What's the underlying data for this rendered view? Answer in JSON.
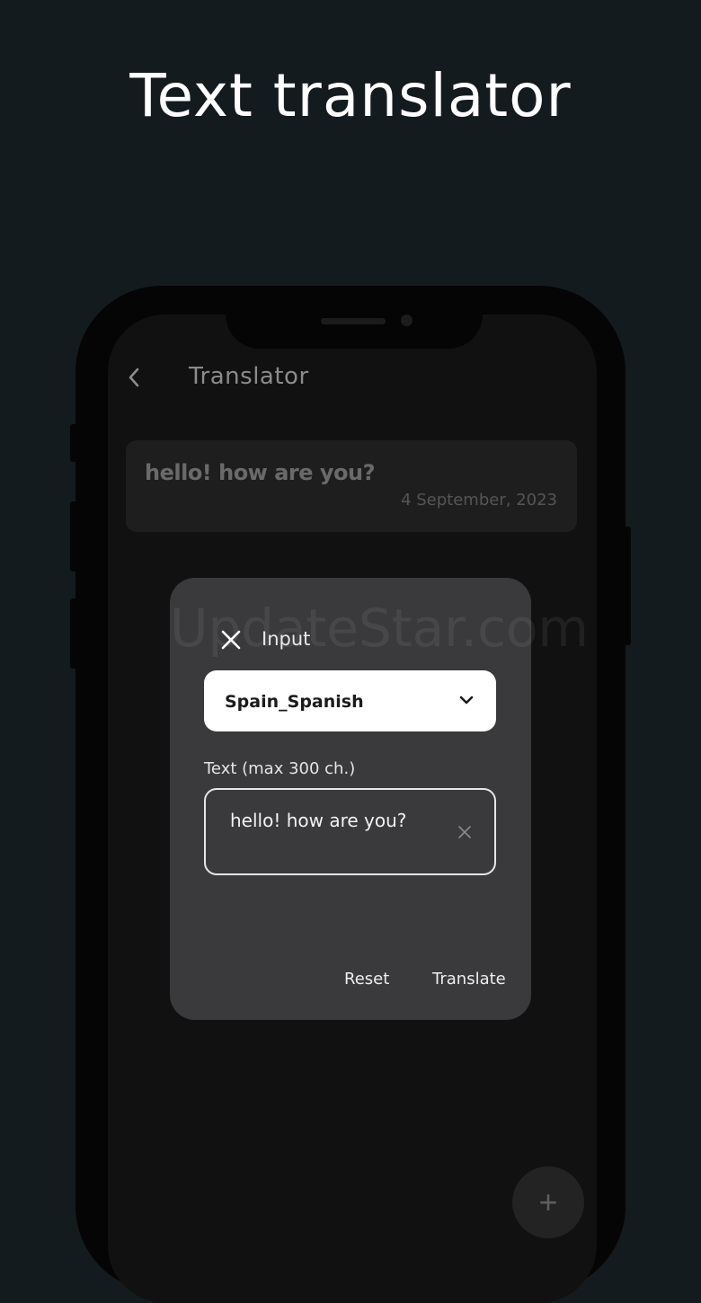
{
  "headline": "Text translator",
  "app": {
    "title": "Translator",
    "back_icon": "chevron-left-icon"
  },
  "history": {
    "text": "hello! how are you?",
    "date": "4 September, 2023"
  },
  "fab": {
    "icon": "plus-icon",
    "glyph": "+"
  },
  "dialog": {
    "watermark": "UpdateStar.com",
    "title": "Input",
    "close_icon": "close-icon",
    "language": {
      "value": "Spain_Spanish",
      "icon": "chevron-down-icon"
    },
    "text_label": "Text (max 300 ch.)",
    "text_value": "hello! how are you?",
    "clear_icon": "clear-icon",
    "reset_label": "Reset",
    "translate_label": "Translate"
  },
  "colors": {
    "page_bg": "#141b1e",
    "phone_frame": "#050505",
    "screen_bg": "#111111",
    "dialog_bg": "#3a3a3c",
    "select_bg": "#ffffff"
  }
}
